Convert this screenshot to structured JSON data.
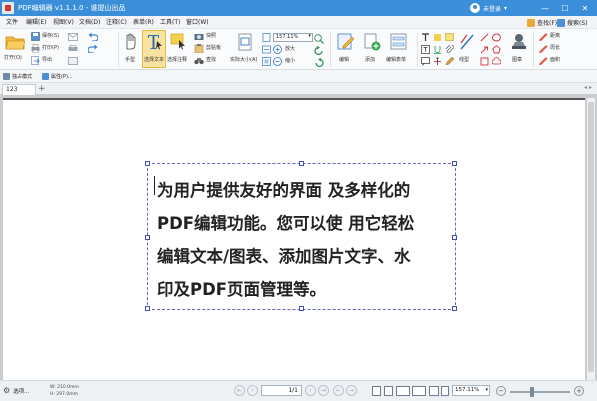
{
  "app": {
    "title": "PDF编辑器 v1.1.1.0 - 谁提山出品",
    "user": "未登录",
    "window_controls": [
      "—",
      "☐",
      "✕"
    ]
  },
  "menu": {
    "items": [
      "文件",
      "编辑(E)",
      "视图(V)",
      "文档(D)",
      "注释(C)",
      "表单(R)",
      "工具(T)",
      "窗口(W)"
    ],
    "find": "查找(F)",
    "search": "搜索(S)"
  },
  "toolbar": {
    "open": "打开(O)",
    "save": "保存(S)",
    "print": "打印(P)",
    "export": "导出",
    "hand": "手型",
    "select_text": "选择文本",
    "select_comment": "选择注释",
    "snapshot": "快照",
    "clipboard": "剪贴板",
    "find": "查找",
    "actual_size": "实际大小(A)",
    "zoom_value": "157.11%",
    "zoom_in": "放大",
    "zoom_out": "缩小",
    "edit": "编辑",
    "add": "添加",
    "edit_form": "编辑表单",
    "line": "线型",
    "stamp": "图章",
    "distance": "距离",
    "perimeter": "周长",
    "area": "面积"
  },
  "subtoolbar": {
    "standalone": "独占模式",
    "properties": "属性(P)..."
  },
  "tabs": {
    "active": "123",
    "add": "+",
    "arrows": "◂▸"
  },
  "document": {
    "lines": [
      "为用户提供友好的界面 及多样化的",
      "PDF编辑功能。您可以使 用它轻松",
      "编辑文本/图表、添加图片文字、水",
      "印及PDF页面管理等。"
    ]
  },
  "statusbar": {
    "select": "选项...",
    "width_label": "W: 210.0mm",
    "height_label": "H: 297.0mm",
    "page": "1/1",
    "zoom": "157.11%",
    "zoom_level_fraction": 0.36
  },
  "colors": {
    "titlebar": "#3b8fd9",
    "selection_border": "#5d68c8"
  }
}
